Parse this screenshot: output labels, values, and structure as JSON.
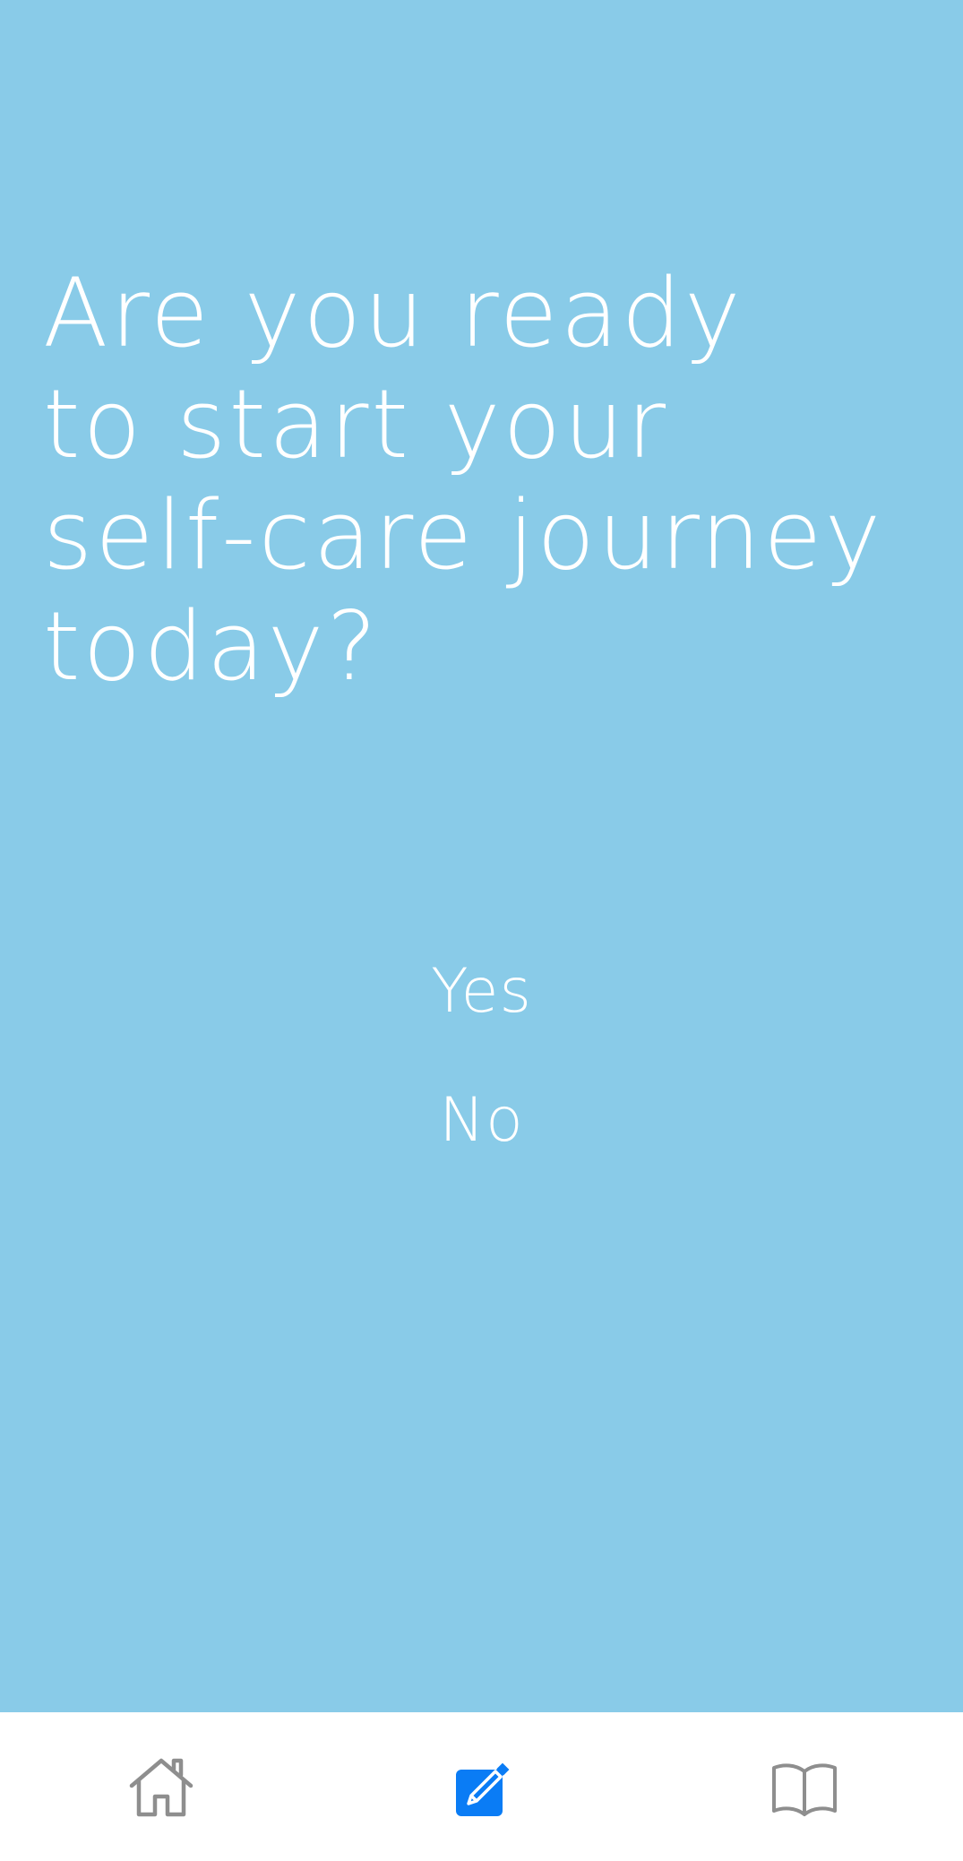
{
  "question": {
    "lines": [
      "Are you ready",
      "to start your",
      "self-care journey",
      "today?"
    ]
  },
  "answers": {
    "yes_label": "Yes",
    "no_label": "No"
  },
  "tabbar": {
    "tabs": [
      {
        "icon": "home-icon",
        "active": false
      },
      {
        "icon": "edit-icon",
        "active": true
      },
      {
        "icon": "book-icon",
        "active": false
      }
    ]
  },
  "colors": {
    "background": "#89CBE8",
    "text": "#FFFFFF",
    "tabbar_background": "#FFFFFF",
    "active_icon": "#0A7CF5",
    "inactive_icon": "#8E8E8E"
  }
}
